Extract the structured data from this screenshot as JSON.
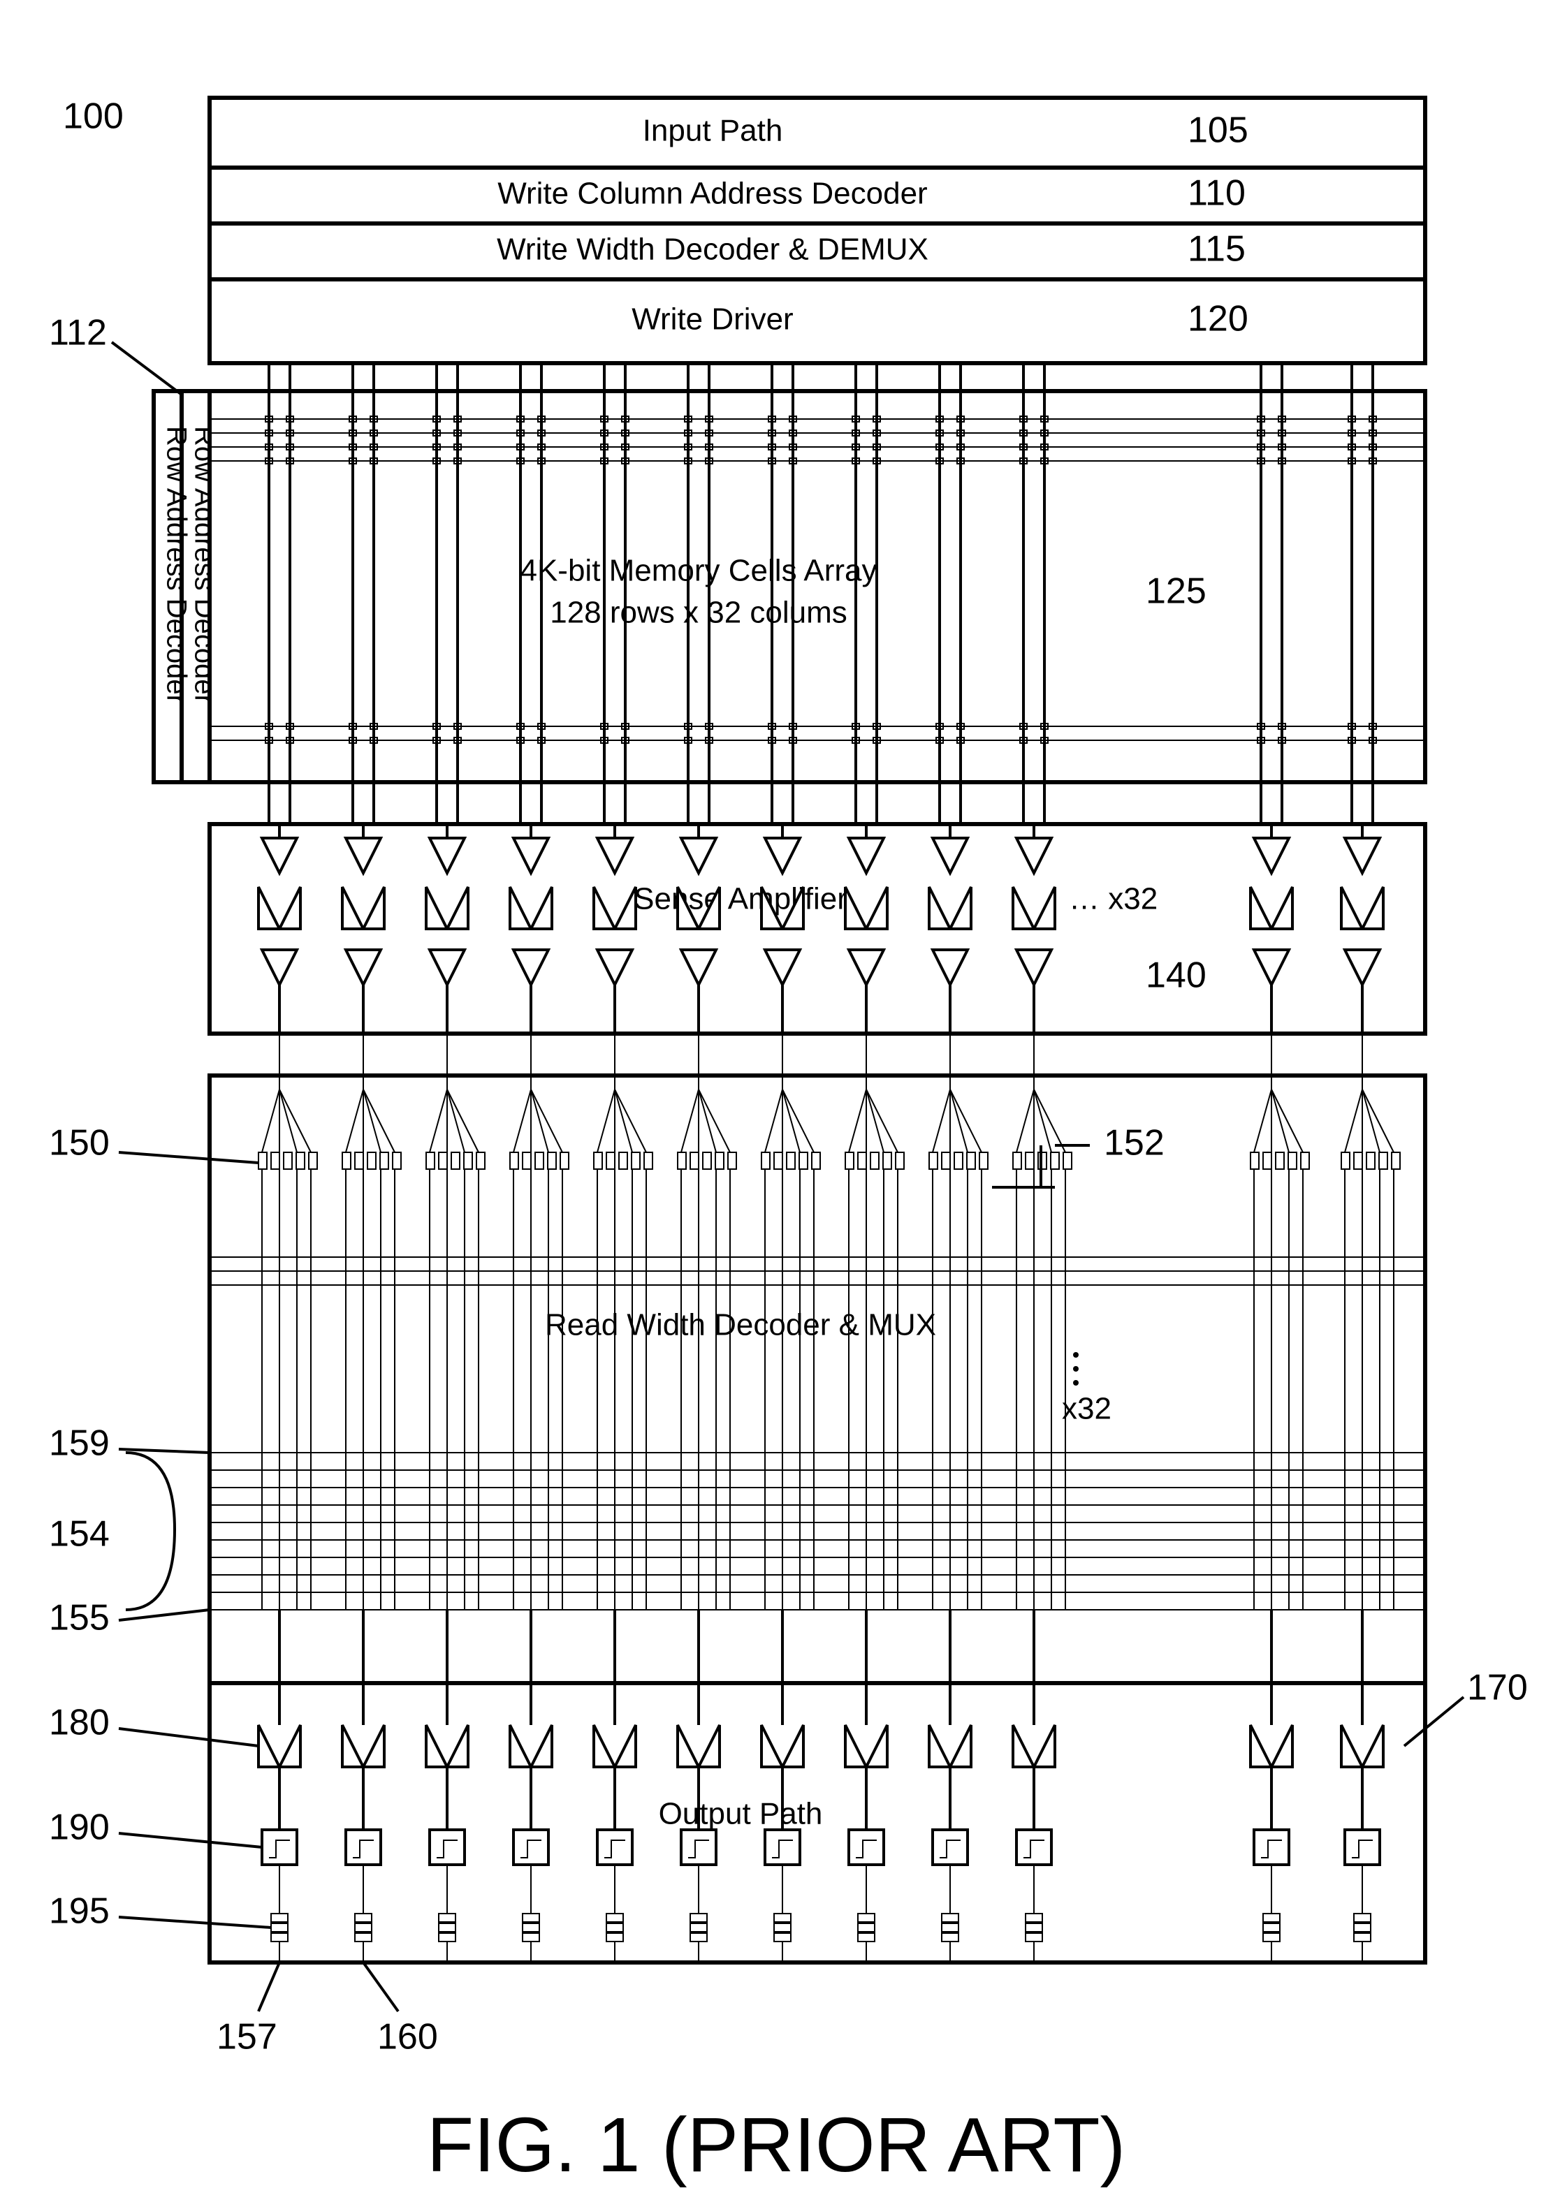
{
  "refs": {
    "r100": "100",
    "r105": "105",
    "r110": "110",
    "r112": "112",
    "r115": "115",
    "r120": "120",
    "r125": "125",
    "r140": "140",
    "r150": "150",
    "r152": "152",
    "r154": "154",
    "r155": "155",
    "r157": "157",
    "r159": "159",
    "r160": "160",
    "r170": "170",
    "r180": "180",
    "r190": "190",
    "r195": "195"
  },
  "blocks": {
    "inputPath": "Input Path",
    "writeColDec": "Write Column Address Decoder",
    "writeWidthDemux": "Write Width Decoder & DEMUX",
    "writeDriver": "Write Driver",
    "rowDec1": "Row Address Decoder",
    "rowDec2": "Row Address Decoder",
    "memArray1": "4K-bit Memory Cells Array",
    "memArray2": "128 rows x 32 colums",
    "senseAmp": "Sense Amplifier",
    "x32a": "… x32",
    "x32b": "x32",
    "readWidthMux": "Read Width Decoder & MUX",
    "outputPath": "Output Path"
  },
  "figure": "FIG. 1 (PRIOR ART)"
}
